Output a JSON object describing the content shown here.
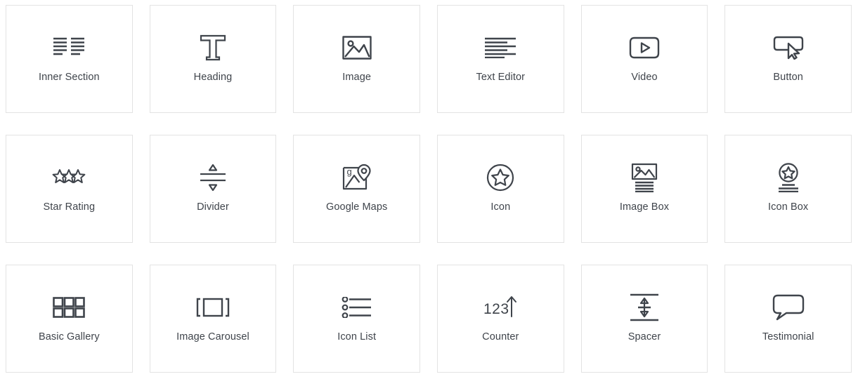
{
  "panel": {
    "name": "elementor-widget-panel",
    "background": "#ffffff",
    "card_border_color": "#e3e3e3",
    "label_color": "#3f444b",
    "icon_color": "#3f444b"
  },
  "widgets": [
    {
      "label": "Inner Section",
      "icon": "inner-section-icon"
    },
    {
      "label": "Heading",
      "icon": "heading-t-icon"
    },
    {
      "label": "Image",
      "icon": "image-picture-icon"
    },
    {
      "label": "Text Editor",
      "icon": "text-editor-lines-icon"
    },
    {
      "label": "Video",
      "icon": "video-play-icon"
    },
    {
      "label": "Button",
      "icon": "button-cursor-icon"
    },
    {
      "label": "Star Rating",
      "icon": "star-rating-icon"
    },
    {
      "label": "Divider",
      "icon": "divider-icon"
    },
    {
      "label": "Google Maps",
      "icon": "google-maps-pin-icon"
    },
    {
      "label": "Icon",
      "icon": "icon-circle-star-icon"
    },
    {
      "label": "Image Box",
      "icon": "image-box-icon"
    },
    {
      "label": "Icon Box",
      "icon": "icon-box-icon"
    },
    {
      "label": "Basic Gallery",
      "icon": "basic-gallery-grid-icon"
    },
    {
      "label": "Image Carousel",
      "icon": "image-carousel-icon"
    },
    {
      "label": "Icon List",
      "icon": "icon-list-icon"
    },
    {
      "label": "Counter",
      "icon": "counter-123-arrow-icon"
    },
    {
      "label": "Spacer",
      "icon": "spacer-arrows-icon"
    },
    {
      "label": "Testimonial",
      "icon": "testimonial-bubble-icon"
    }
  ]
}
